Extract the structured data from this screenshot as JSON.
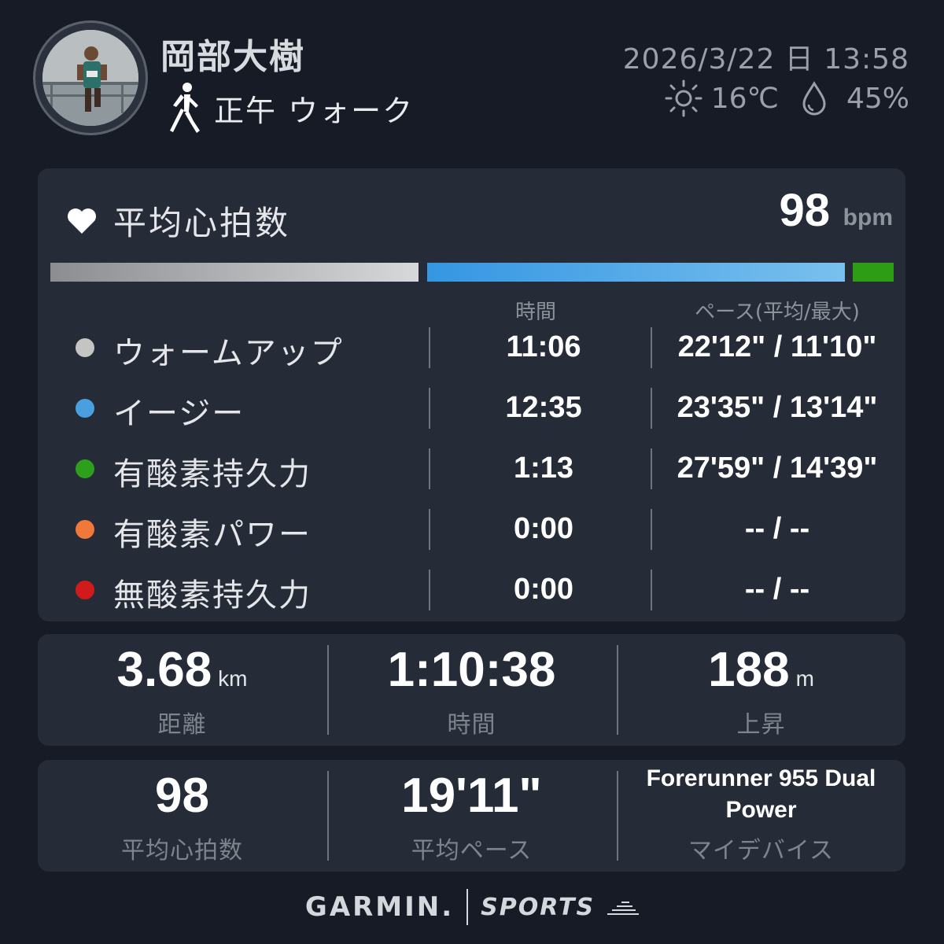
{
  "header": {
    "user_name": "岡部大樹",
    "activity_icon": "walking-person-icon",
    "activity_label": "正午 ウォーク",
    "datetime": "2026/3/22 日 13:58",
    "weather": {
      "icon": "sun-icon",
      "temperature": "16℃",
      "humidity_icon": "water-drop-icon",
      "humidity": "45%"
    }
  },
  "heart_rate": {
    "icon": "heart-icon",
    "title": "平均心拍数",
    "value": "98",
    "unit": "bpm",
    "col_time_header": "時間",
    "col_pace_header": "ペース(平均/最大)",
    "zones": [
      {
        "name": "ウォームアップ",
        "time": "11:06",
        "pace": "22'12\" / 11'10\"",
        "color": "#c4c4c4"
      },
      {
        "name": "イージー",
        "time": "12:35",
        "pace": "23'35\" / 13'14\"",
        "color": "#4a9fe0"
      },
      {
        "name": "有酸素持久力",
        "time": "1:13",
        "pace": "27'59\" / 14'39\"",
        "color": "#2ca01c"
      },
      {
        "name": "有酸素パワー",
        "time": "0:00",
        "pace": "-- / --",
        "color": "#f0793a"
      },
      {
        "name": "無酸素持久力",
        "time": "0:00",
        "pace": "-- / --",
        "color": "#d11a1a"
      }
    ]
  },
  "stats_row1": [
    {
      "value": "3.68",
      "unit": "km",
      "label": "距離"
    },
    {
      "value": "1:10:38",
      "unit": "",
      "label": "時間"
    },
    {
      "value": "188",
      "unit": "m",
      "label": "上昇"
    }
  ],
  "stats_row2": [
    {
      "value": "98",
      "label": "平均心拍数"
    },
    {
      "value": "19'11\"",
      "label": "平均ペース"
    },
    {
      "value": "Forerunner 955 Dual Power",
      "label": "マイデバイス"
    }
  ],
  "footer": {
    "brand": "GARMIN.",
    "app": "SPORTS"
  }
}
